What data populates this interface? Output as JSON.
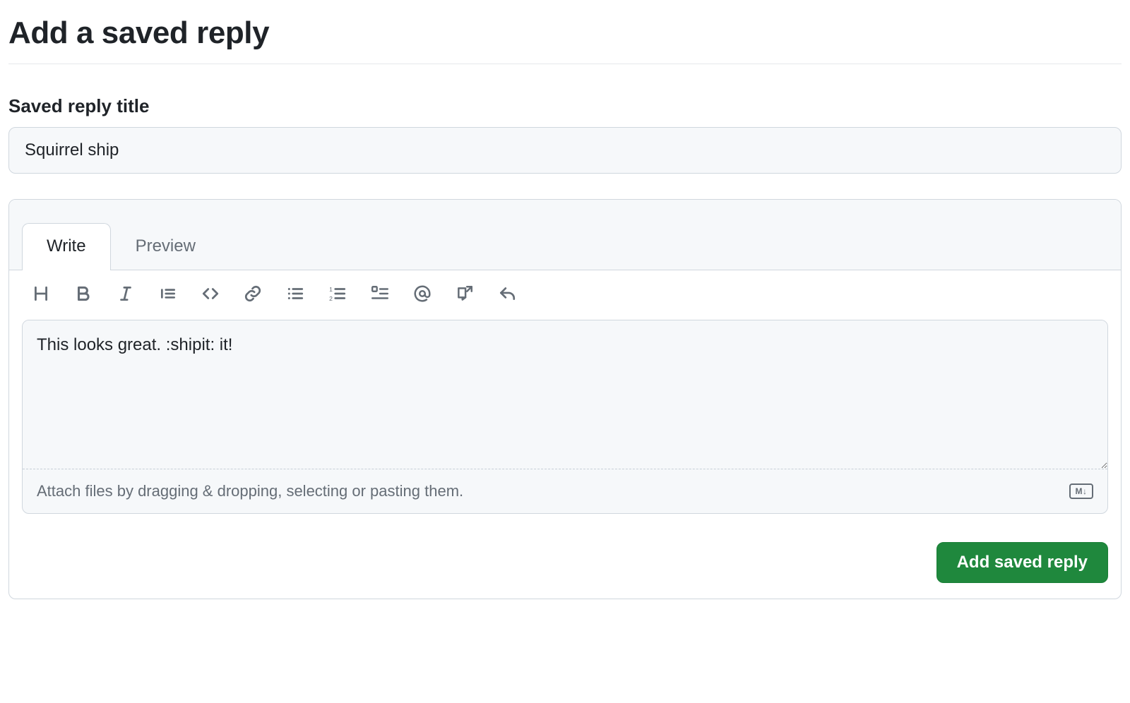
{
  "page": {
    "title": "Add a saved reply"
  },
  "title_field": {
    "label": "Saved reply title",
    "value": "Squirrel ship"
  },
  "editor": {
    "tabs": {
      "write": "Write",
      "preview": "Preview",
      "active": "write"
    },
    "toolbar_icons": [
      "heading-icon",
      "bold-icon",
      "italic-icon",
      "quote-icon",
      "code-icon",
      "link-icon",
      "unordered-list-icon",
      "ordered-list-icon",
      "task-list-icon",
      "mention-icon",
      "cross-reference-icon",
      "saved-reply-icon"
    ],
    "body_value": "This looks great. :shipit: it!",
    "attach_hint": "Attach files by dragging & dropping, selecting or pasting them.",
    "md_badge": "M↓"
  },
  "actions": {
    "submit_label": "Add saved reply"
  },
  "colors": {
    "accent": "#1f883d",
    "border": "#d0d7de",
    "muted": "#656d76",
    "bg_subtle": "#f6f8fa"
  }
}
